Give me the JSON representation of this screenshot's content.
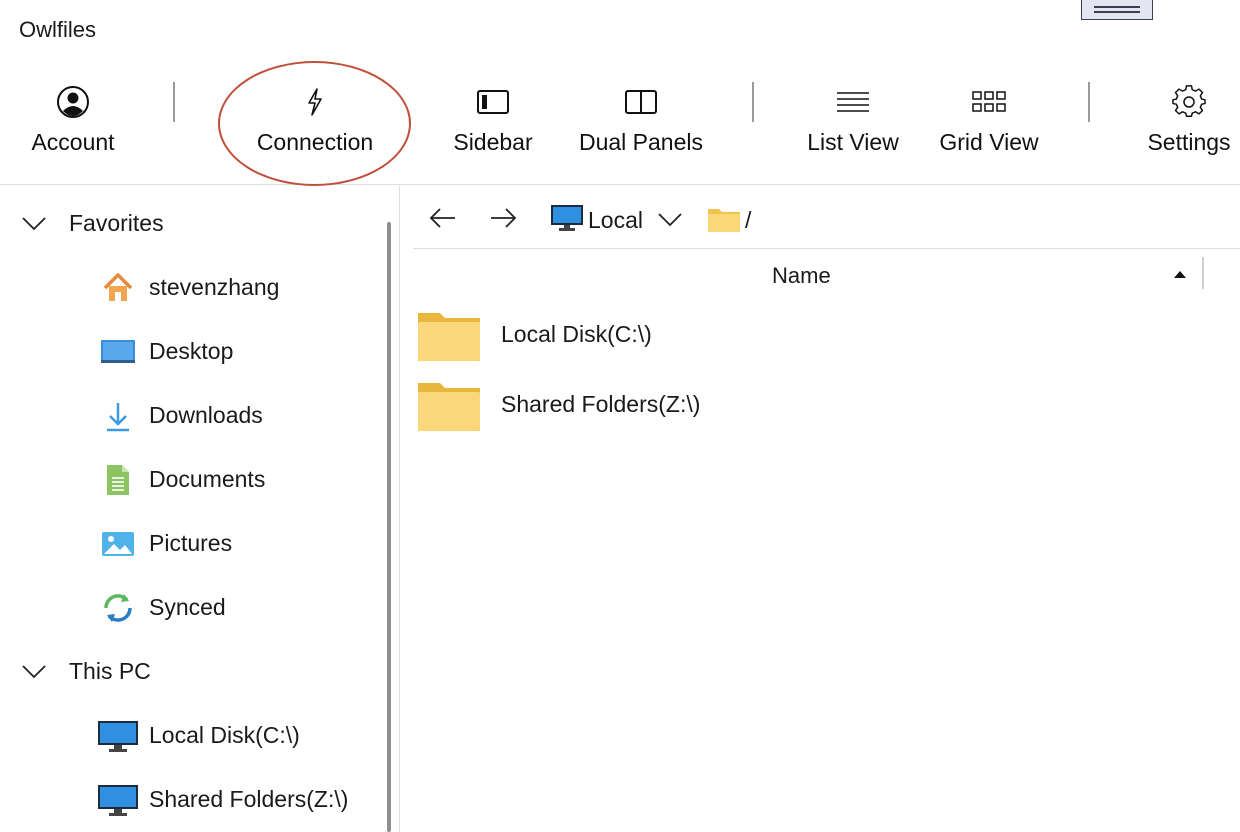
{
  "app": {
    "title": "Owlfiles"
  },
  "toolbar": {
    "account": "Account",
    "connection": "Connection",
    "sidebar": "Sidebar",
    "dual_panels": "Dual Panels",
    "list_view": "List View",
    "grid_view": "Grid View",
    "settings": "Settings"
  },
  "sidebar": {
    "favorites": {
      "label": "Favorites",
      "items": [
        {
          "label": "stevenzhang",
          "icon": "home-icon"
        },
        {
          "label": "Desktop",
          "icon": "desktop-icon"
        },
        {
          "label": "Downloads",
          "icon": "download-icon"
        },
        {
          "label": "Documents",
          "icon": "document-icon"
        },
        {
          "label": "Pictures",
          "icon": "pictures-icon"
        },
        {
          "label": "Synced",
          "icon": "sync-icon"
        }
      ]
    },
    "this_pc": {
      "label": "This PC",
      "items": [
        {
          "label": "Local Disk(C:\\)",
          "icon": "monitor-icon"
        },
        {
          "label": "Shared Folders(Z:\\)",
          "icon": "monitor-icon"
        }
      ]
    }
  },
  "navbar": {
    "location": "Local",
    "path": "/"
  },
  "file_list": {
    "column_name": "Name",
    "sort": "ascending",
    "rows": [
      {
        "name": "Local Disk(C:\\)",
        "icon": "folder-icon"
      },
      {
        "name": "Shared Folders(Z:\\)",
        "icon": "folder-icon"
      }
    ]
  },
  "colors": {
    "highlight": "#c0503c",
    "folder": "#f6d66f",
    "monitor": "#2f7fcf"
  }
}
